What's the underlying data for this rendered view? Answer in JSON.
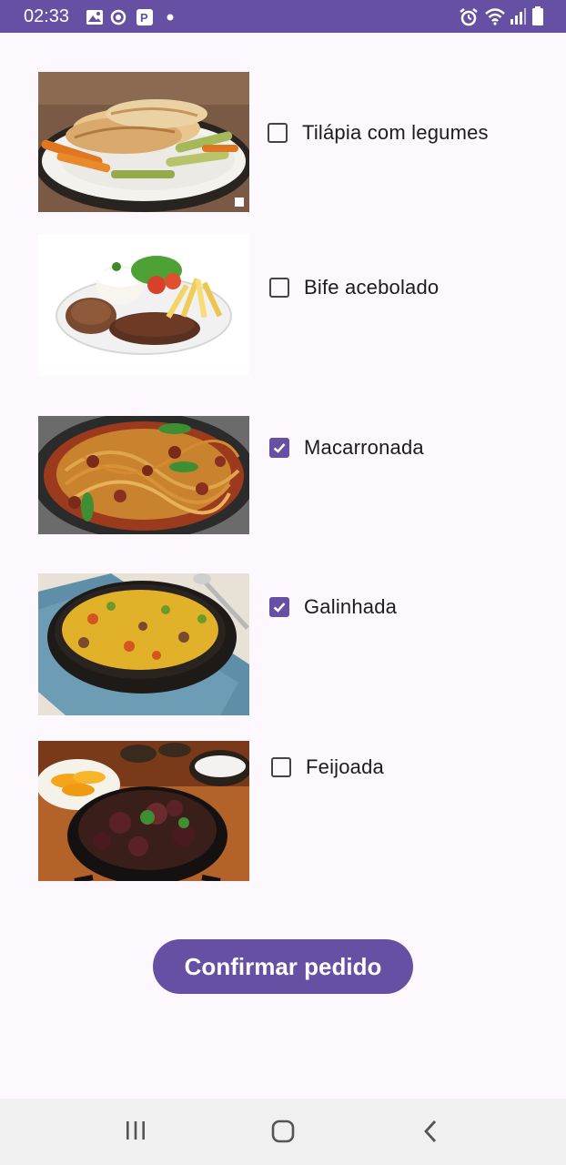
{
  "status_bar": {
    "time": "02:33",
    "left_icons": [
      "gallery-icon",
      "sync-icon",
      "parking-icon",
      "dot-icon"
    ],
    "right_icons": [
      "alarm-icon",
      "wifi-icon",
      "signal-icon",
      "battery-icon"
    ]
  },
  "menu": {
    "items": [
      {
        "label": "Tilápia com legumes",
        "checked": false,
        "image": "tilapia-photo"
      },
      {
        "label": "Bife acebolado",
        "checked": false,
        "image": "bife-photo"
      },
      {
        "label": "Macarronada",
        "checked": true,
        "image": "macarronada-photo"
      },
      {
        "label": "Galinhada",
        "checked": true,
        "image": "galinhada-photo"
      },
      {
        "label": "Feijoada",
        "checked": false,
        "image": "feijoada-photo"
      }
    ]
  },
  "confirm_button": {
    "label": "Confirmar pedido"
  },
  "nav_bar": {
    "buttons": [
      "recent-apps-icon",
      "home-icon",
      "back-icon"
    ]
  },
  "colors": {
    "accent": "#6650a4",
    "background": "#fdf8fd",
    "nav": "#f0f0f0"
  }
}
